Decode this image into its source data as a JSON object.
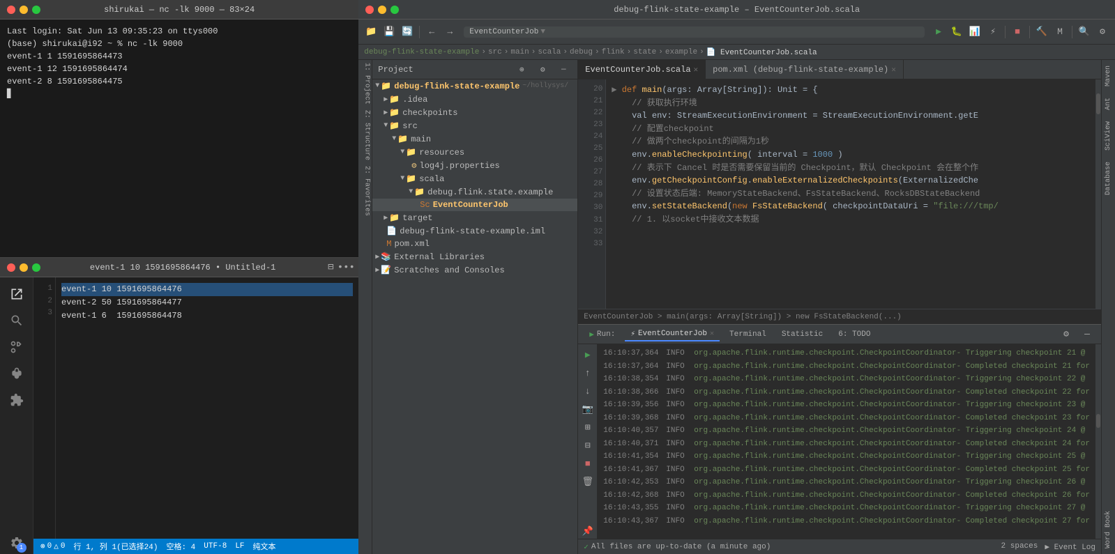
{
  "terminal": {
    "title": "shirukai — nc -lk 9000 — 83×24",
    "lines": [
      "Last login: Sat Jun 13 09:35:23 on ttys000",
      "(base) shirukai@i92 ~ % nc -lk 9000",
      "event-1 1 1591695864473",
      "event-1 12 1591695864474",
      "event-2 8 1591695864475"
    ]
  },
  "editor": {
    "title": "event-1 10 1591695864476 • Untitled-1",
    "lines": [
      {
        "num": "1",
        "text": "event-1 10 1591695864476",
        "selected": true
      },
      {
        "num": "2",
        "text": "event-2 50 1591695864477",
        "selected": false
      },
      {
        "num": "3",
        "text": "event-1 6  1591695864478",
        "selected": false
      }
    ],
    "status": {
      "row": "行 1, 列 1(已选择24)",
      "spaces": "空格: 4",
      "encoding": "UTF-8",
      "eol": "LF",
      "type": "纯文本",
      "errors": "⊗ 0",
      "warnings": "△ 0"
    }
  },
  "intellij": {
    "title": "debug-flink-state-example – EventCounterJob.scala",
    "toolbar": {
      "breadcrumb": "EventCounterJob"
    },
    "breadcrumb_path": [
      "debug-flink-state-example",
      "src",
      "main",
      "scala",
      "debug",
      "flink",
      "state",
      "example",
      "EventCounterJob.scala"
    ],
    "tabs": [
      {
        "label": "EventCounterJob.scala",
        "active": true
      },
      {
        "label": "pom.xml (debug-flink-state-example)",
        "active": false
      }
    ],
    "filetree": {
      "title": "Project",
      "items": [
        {
          "indent": 0,
          "type": "folder",
          "label": "debug-flink-state-example",
          "suffix": "~/hollysys/",
          "open": true,
          "highlight": true
        },
        {
          "indent": 1,
          "type": "folder",
          "label": ".idea",
          "open": false
        },
        {
          "indent": 1,
          "type": "folder",
          "label": "checkpoints",
          "open": false
        },
        {
          "indent": 1,
          "type": "folder",
          "label": "src",
          "open": true
        },
        {
          "indent": 2,
          "type": "folder",
          "label": "main",
          "open": true
        },
        {
          "indent": 3,
          "type": "folder",
          "label": "resources",
          "open": true
        },
        {
          "indent": 4,
          "type": "file",
          "label": "log4j.properties",
          "icon": "prop"
        },
        {
          "indent": 3,
          "type": "folder",
          "label": "scala",
          "open": true
        },
        {
          "indent": 4,
          "type": "folder",
          "label": "debug.flink.state.example",
          "open": true
        },
        {
          "indent": 5,
          "type": "file",
          "label": "EventCounterJob",
          "icon": "scala"
        },
        {
          "indent": 1,
          "type": "folder",
          "label": "target",
          "open": false
        },
        {
          "indent": 1,
          "type": "file",
          "label": "debug-flink-state-example.iml",
          "icon": "iml"
        },
        {
          "indent": 1,
          "type": "file",
          "label": "pom.xml",
          "icon": "pom"
        },
        {
          "indent": 0,
          "type": "folder",
          "label": "External Libraries",
          "open": false
        },
        {
          "indent": 0,
          "type": "folder",
          "label": "Scratches and Consoles",
          "open": false
        }
      ]
    },
    "code_lines": [
      {
        "num": "20",
        "text": "  def main(args: Array[String]): Unit = {",
        "has_arrow": true
      },
      {
        "num": "21",
        "text": "    // 获取执行环境"
      },
      {
        "num": "22",
        "text": "    val env: StreamExecutionEnvironment = StreamExecutionEnvironment.getE"
      },
      {
        "num": "23",
        "text": ""
      },
      {
        "num": "24",
        "text": "    // 配置checkpoint"
      },
      {
        "num": "25",
        "text": "    // 做两个checkpoint的间隔为1秒"
      },
      {
        "num": "26",
        "text": "    env.enableCheckpointing( interval = 1000 )"
      },
      {
        "num": "27",
        "text": "    // 表示下 Cancel 时是否需要保留当前的 Checkpoint，默认 Checkpoint 会在整个作"
      },
      {
        "num": "28",
        "text": "    env.getCheckpointConfig.enableExternalizedCheckpoints(ExternalizedChe"
      },
      {
        "num": "29",
        "text": "    // 设置状态后端: MemoryStateBackend、FsStateBackend、RocksDBStateBackend"
      },
      {
        "num": "30",
        "text": "    env.setStateBackend(new FsStateBackend( checkpointDataUri = \"file:///tmp/"
      },
      {
        "num": "31",
        "text": ""
      },
      {
        "num": "32",
        "text": ""
      },
      {
        "num": "33",
        "text": "    // 1. 以socket中接收文本数据"
      }
    ],
    "code_breadcrumb": "EventCounterJob > main(args: Array[String]) > new FsStateBackend(...)",
    "run_panel": {
      "current_run": "EventCounterJob",
      "tabs": [
        "Run:",
        "EventCounterJob",
        "Terminal",
        "Statistic",
        "6: TODO"
      ],
      "log_lines": [
        {
          "time": "16:10:37,364",
          "level": "INFO",
          "class": "org.apache.flink.runtime.checkpoint.CheckpointCoordinator",
          "msg": "- Triggering checkpoint 21 @"
        },
        {
          "time": "16:10:37,364",
          "level": "INFO",
          "class": "org.apache.flink.runtime.checkpoint.CheckpointCoordinator",
          "msg": "- Completed checkpoint 21 for"
        },
        {
          "time": "16:10:38,354",
          "level": "INFO",
          "class": "org.apache.flink.runtime.checkpoint.CheckpointCoordinator",
          "msg": "- Triggering checkpoint 22 @"
        },
        {
          "time": "16:10:38,366",
          "level": "INFO",
          "class": "org.apache.flink.runtime.checkpoint.CheckpointCoordinator",
          "msg": "- Completed checkpoint 22 for"
        },
        {
          "time": "16:10:39,356",
          "level": "INFO",
          "class": "org.apache.flink.runtime.checkpoint.CheckpointCoordinator",
          "msg": "- Triggering checkpoint 23 @"
        },
        {
          "time": "16:10:39,368",
          "level": "INFO",
          "class": "org.apache.flink.runtime.checkpoint.CheckpointCoordinator",
          "msg": "- Completed checkpoint 23 for"
        },
        {
          "time": "16:10:40,357",
          "level": "INFO",
          "class": "org.apache.flink.runtime.checkpoint.CheckpointCoordinator",
          "msg": "- Triggering checkpoint 24 @"
        },
        {
          "time": "16:10:40,371",
          "level": "INFO",
          "class": "org.apache.flink.runtime.checkpoint.CheckpointCoordinator",
          "msg": "- Completed checkpoint 24 for"
        },
        {
          "time": "16:10:41,354",
          "level": "INFO",
          "class": "org.apache.flink.runtime.checkpoint.CheckpointCoordinator",
          "msg": "- Triggering checkpoint 25 @"
        },
        {
          "time": "16:10:41,367",
          "level": "INFO",
          "class": "org.apache.flink.runtime.checkpoint.CheckpointCoordinator",
          "msg": "- Completed checkpoint 25 for"
        },
        {
          "time": "16:10:42,353",
          "level": "INFO",
          "class": "org.apache.flink.runtime.checkpoint.CheckpointCoordinator",
          "msg": "- Triggering checkpoint 26 @"
        },
        {
          "time": "16:10:42,368",
          "level": "INFO",
          "class": "org.apache.flink.runtime.checkpoint.CheckpointCoordinator",
          "msg": "- Completed checkpoint 26 for"
        },
        {
          "time": "16:10:43,355",
          "level": "INFO",
          "class": "org.apache.flink.runtime.checkpoint.CheckpointCoordinator",
          "msg": "- Triggering checkpoint 27 @"
        },
        {
          "time": "16:10:43,367",
          "level": "INFO",
          "class": "org.apache.flink.runtime.checkpoint.CheckpointCoordinator",
          "msg": "- Completed checkpoint 27 for"
        }
      ],
      "status_msg": "All files are up-to-date (a minute ago)"
    },
    "right_sidebar": [
      "Maven",
      "Ant",
      "SciView",
      "Database",
      "Word Book"
    ],
    "vert_labels": [
      "1: Project",
      "Z: Structure",
      "2: Favorites"
    ],
    "bottom": {
      "spaces": "2 spaces",
      "event_log": "▶ Event Log"
    }
  }
}
